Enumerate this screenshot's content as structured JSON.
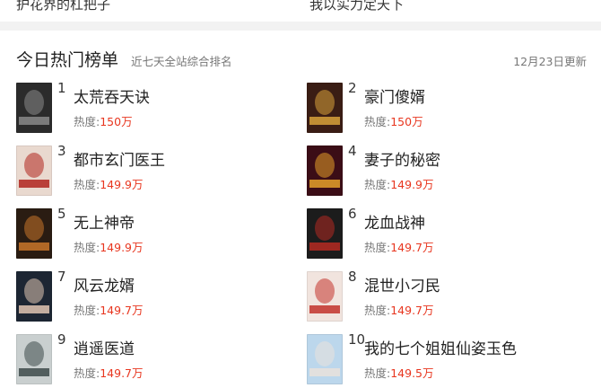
{
  "previous_row": {
    "left_text": "护花界的杠把子",
    "right_text": "我以实力定天下"
  },
  "section": {
    "title": "今日热门榜单",
    "subtitle": "近七天全站综合排名",
    "update_text": "12月23日更新"
  },
  "heat_prefix": "热度:",
  "books": [
    {
      "rank": "1",
      "title": "太荒吞天诀",
      "heat": "150万",
      "cover_color": "#2b2b2b",
      "cover_accent": "#8a8a8a"
    },
    {
      "rank": "2",
      "title": "豪门傻婿",
      "heat": "150万",
      "cover_color": "#3a1d14",
      "cover_accent": "#d8a23a"
    },
    {
      "rank": "3",
      "title": "都市玄门医王",
      "heat": "149.9万",
      "cover_color": "#e9d9cf",
      "cover_accent": "#b0241e"
    },
    {
      "rank": "4",
      "title": "妻子的秘密",
      "heat": "149.9万",
      "cover_color": "#3b0d16",
      "cover_accent": "#e5a12a"
    },
    {
      "rank": "5",
      "title": "无上神帝",
      "heat": "149.9万",
      "cover_color": "#2a1c12",
      "cover_accent": "#c9762a"
    },
    {
      "rank": "6",
      "title": "龙血战神",
      "heat": "149.7万",
      "cover_color": "#1c1c1c",
      "cover_accent": "#b52a22"
    },
    {
      "rank": "7",
      "title": "风云龙婿",
      "heat": "149.7万",
      "cover_color": "#1d2633",
      "cover_accent": "#e0c6b3"
    },
    {
      "rank": "8",
      "title": "混世小刁民",
      "heat": "149.7万",
      "cover_color": "#f1e4de",
      "cover_accent": "#c2332b"
    },
    {
      "rank": "9",
      "title": "逍遥医道",
      "heat": "149.7万",
      "cover_color": "#c9cfcf",
      "cover_accent": "#3d4a4a"
    },
    {
      "rank": "10",
      "title": "我的七个姐姐仙姿玉色",
      "heat": "149.5万",
      "cover_color": "#bcd7ec",
      "cover_accent": "#e9e2dc"
    }
  ]
}
